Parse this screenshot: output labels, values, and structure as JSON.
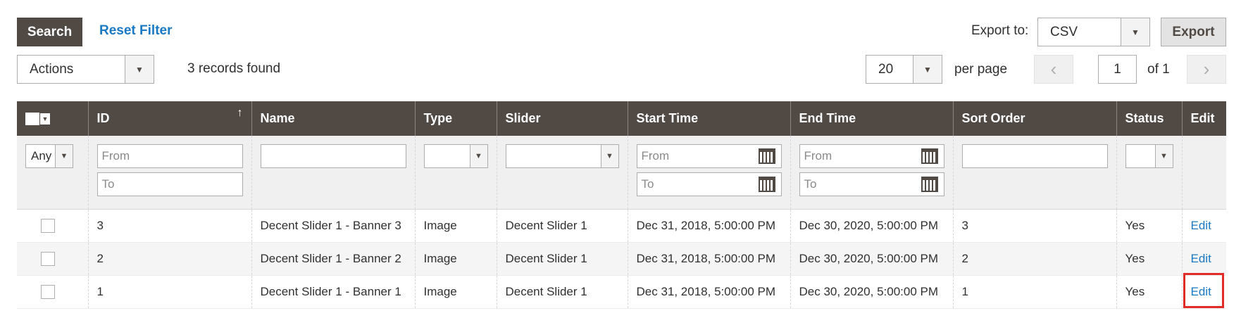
{
  "toolbar": {
    "search_label": "Search",
    "reset_label": "Reset Filter",
    "export_label": "Export to:",
    "export_value": "CSV",
    "export_button": "Export"
  },
  "massaction": {
    "actions_value": "Actions"
  },
  "records_found": "3 records found",
  "pager": {
    "per_page_value": "20",
    "per_page_label": "per page",
    "prev_icon": "‹",
    "next_icon": "›",
    "current_page": "1",
    "of_label": "of 1"
  },
  "columns": [
    "ID",
    "Name",
    "Type",
    "Slider",
    "Start Time",
    "End Time",
    "Sort Order",
    "Status",
    "Edit"
  ],
  "sort_indicator": "↑",
  "filters": {
    "status_any": "Any",
    "from_placeholder": "From",
    "to_placeholder": "To"
  },
  "rows": [
    {
      "id": "3",
      "name": "Decent Slider 1 - Banner 3",
      "type": "Image",
      "slider": "Decent Slider 1",
      "start": "Dec 31, 2018, 5:00:00 PM",
      "end": "Dec 30, 2020, 5:00:00 PM",
      "sort": "3",
      "status": "Yes",
      "edit": "Edit"
    },
    {
      "id": "2",
      "name": "Decent Slider 1 - Banner 2",
      "type": "Image",
      "slider": "Decent Slider 1",
      "start": "Dec 31, 2018, 5:00:00 PM",
      "end": "Dec 30, 2020, 5:00:00 PM",
      "sort": "2",
      "status": "Yes",
      "edit": "Edit"
    },
    {
      "id": "1",
      "name": "Decent Slider 1 - Banner 1",
      "type": "Image",
      "slider": "Decent Slider 1",
      "start": "Dec 31, 2018, 5:00:00 PM",
      "end": "Dec 30, 2020, 5:00:00 PM",
      "sort": "1",
      "status": "Yes",
      "edit": "Edit"
    }
  ],
  "colors": {
    "header_bg": "#514943",
    "link": "#1979c3",
    "highlight": "#e02b27"
  }
}
